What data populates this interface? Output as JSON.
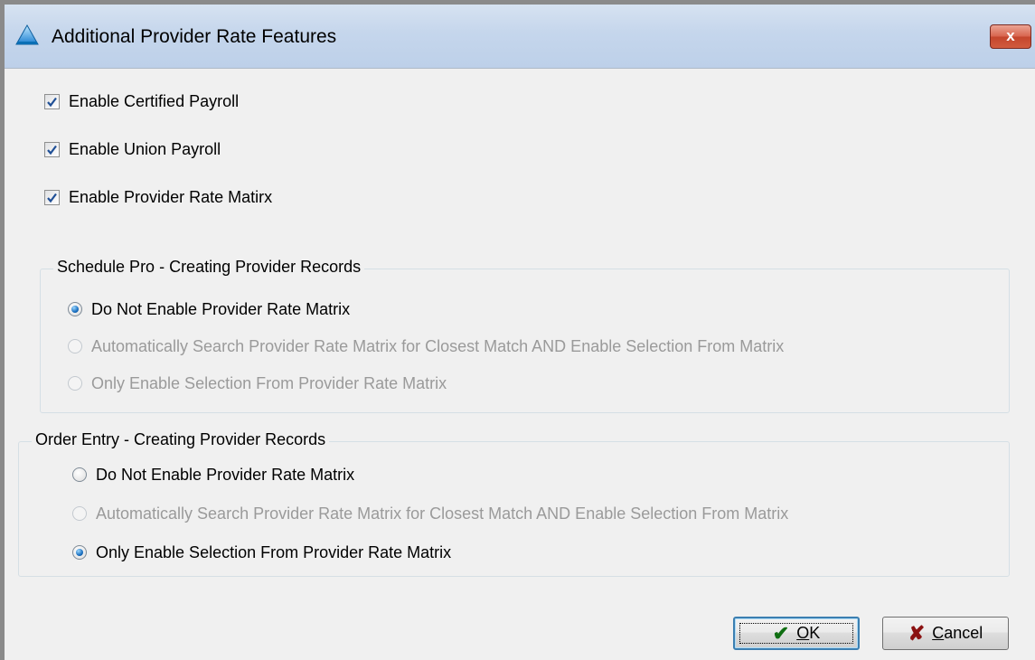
{
  "window": {
    "title": "Additional Provider Rate Features",
    "close_label": "x"
  },
  "options": [
    {
      "label": "Enable Certified Payroll",
      "checked": true
    },
    {
      "label": "Enable Union Payroll",
      "checked": true
    },
    {
      "label": "Enable Provider Rate Matirx",
      "checked": true
    }
  ],
  "schedule_pro": {
    "legend": "Schedule Pro - Creating Provider Records",
    "radios": [
      {
        "label": "Do Not Enable Provider Rate Matrix",
        "selected": true,
        "enabled": true
      },
      {
        "label": "Automatically Search Provider Rate Matrix for Closest Match AND Enable Selection From Matrix",
        "selected": false,
        "enabled": false
      },
      {
        "label": "Only Enable Selection From Provider Rate Matrix",
        "selected": false,
        "enabled": false
      }
    ]
  },
  "order_entry": {
    "legend": "Order Entry - Creating Provider Records",
    "radios": [
      {
        "label": "Do Not Enable Provider Rate Matrix",
        "selected": false,
        "enabled": true
      },
      {
        "label": "Automatically Search Provider Rate Matrix for Closest Match AND Enable Selection From Matrix",
        "selected": false,
        "enabled": false
      },
      {
        "label": "Only Enable Selection From Provider Rate Matrix",
        "selected": true,
        "enabled": true
      }
    ]
  },
  "buttons": {
    "ok": {
      "accel": "O",
      "rest": "K",
      "icon": "check-icon"
    },
    "cancel": {
      "accel": "C",
      "rest": "ancel",
      "icon": "x-icon"
    }
  },
  "colors": {
    "title_bar": "#c5d6ec",
    "close_button": "#c4452c",
    "ok_icon": "#0f6e12",
    "cancel_icon": "#8b1111",
    "radio_selected": "#1a6fc0"
  }
}
